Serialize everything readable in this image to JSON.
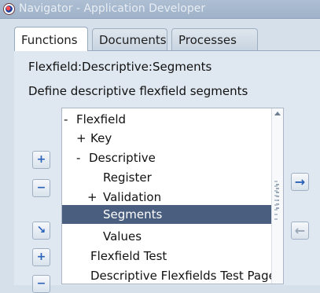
{
  "window": {
    "title": "Navigator - Application Developer"
  },
  "tabs": [
    {
      "label": "Functions",
      "active": true
    },
    {
      "label": "Documents",
      "active": false
    },
    {
      "label": "Processes",
      "active": false
    }
  ],
  "main": {
    "path": "Flexfield:Descriptive:Segments",
    "description": "Define descriptive flexfield segments"
  },
  "tree": {
    "items": [
      {
        "prefix": "-",
        "label": "Flexfield"
      },
      {
        "prefix": "+",
        "label": "Key"
      },
      {
        "prefix": "-",
        "label": "Descriptive"
      },
      {
        "prefix": "",
        "label": "Register"
      },
      {
        "prefix": "+",
        "label": "Validation"
      },
      {
        "prefix": "",
        "label": "Segments",
        "selected": true
      },
      {
        "prefix": "",
        "label": "Values"
      },
      {
        "prefix": "",
        "label": "Flexfield Test"
      },
      {
        "prefix": "",
        "label": "Descriptive Flexfields Test Page"
      }
    ]
  },
  "buttons": {
    "add": "+",
    "remove": "−",
    "add_sub": "↘",
    "add_sibling": "+",
    "move": "−",
    "right": "→",
    "left": "←"
  },
  "colors": {
    "selection": "#4a5f7f",
    "accent": "#2a62b8"
  }
}
